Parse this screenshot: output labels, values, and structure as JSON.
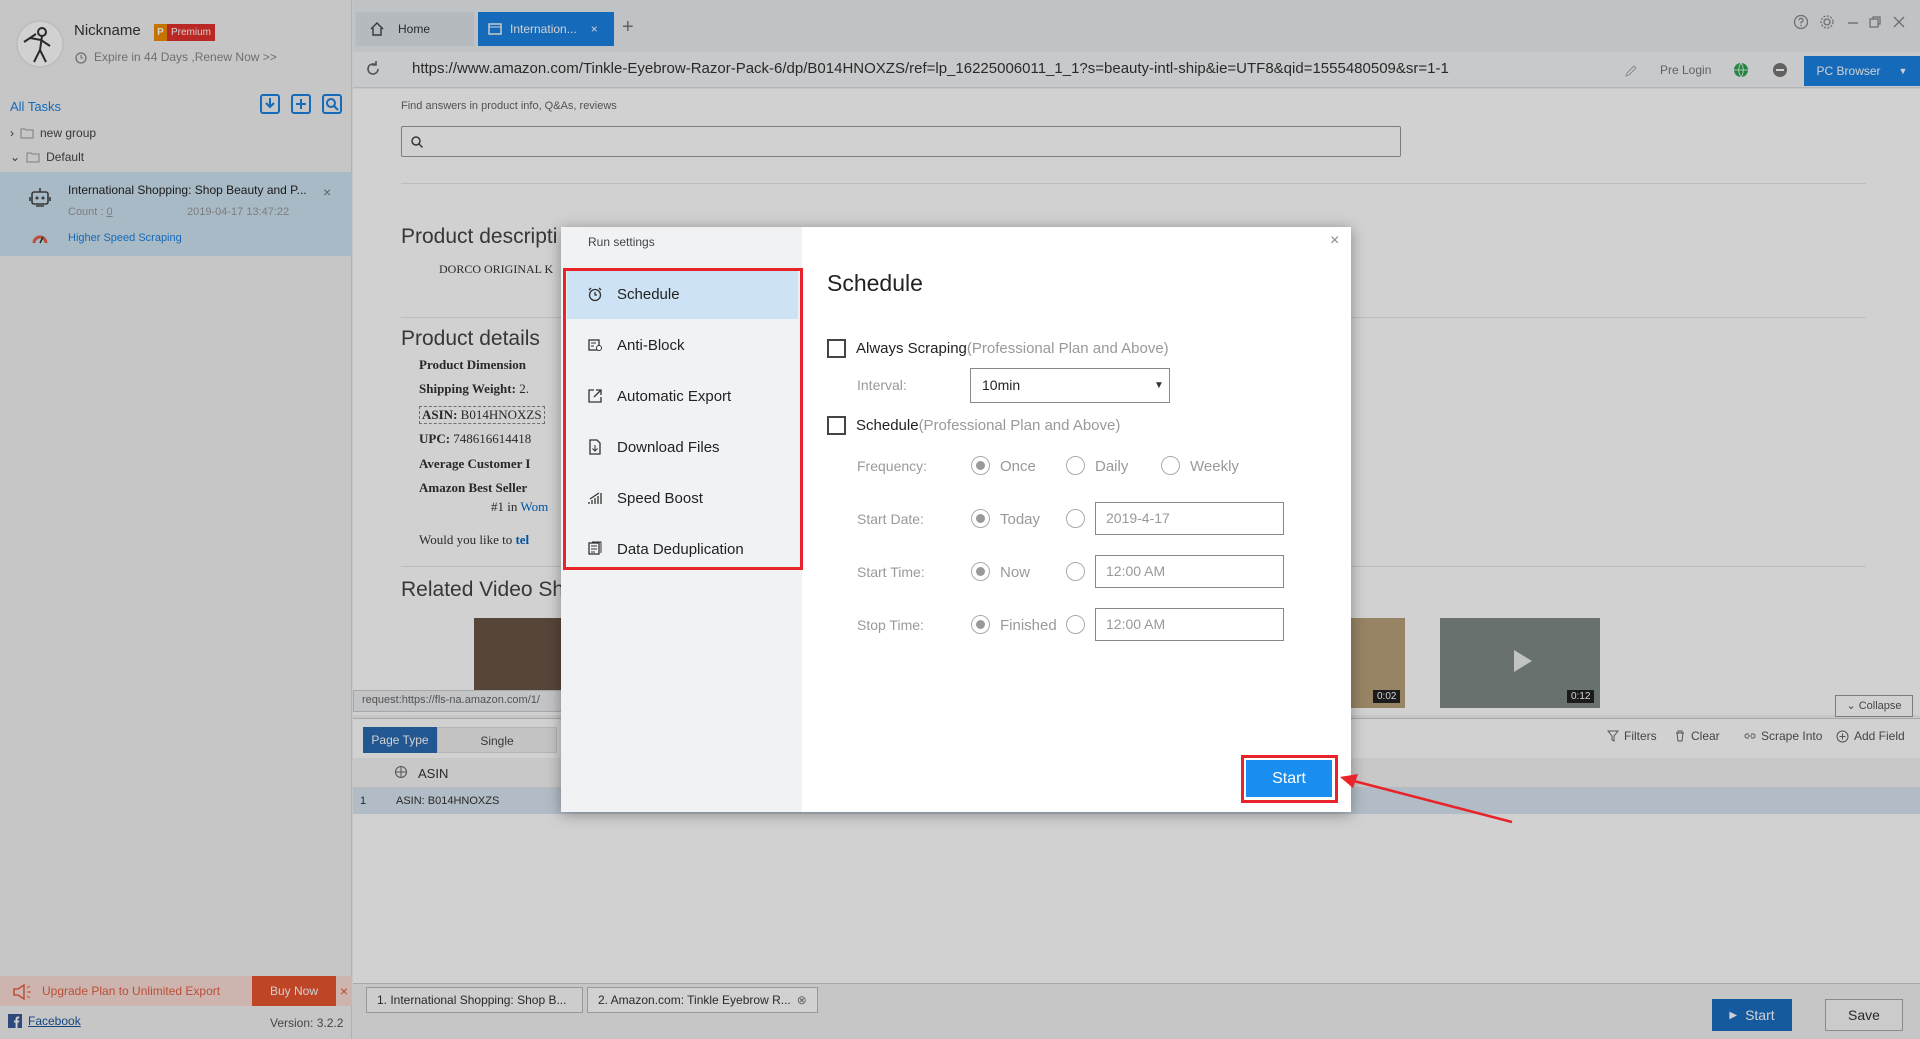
{
  "sidebar": {
    "nickname": "Nickname",
    "badge_p": "P",
    "badge_label": "Premium",
    "expire_text": "Expire in 44 Days ,Renew Now >>",
    "all_tasks": "All Tasks",
    "groups": [
      "new group",
      "Default"
    ],
    "task": {
      "title": "International Shopping: Shop Beauty and P...",
      "count_label": "Count :",
      "count_value": "0",
      "date": "2019-04-17 13:47:22",
      "speed": "Higher Speed Scraping"
    },
    "upgrade": "Upgrade Plan to Unlimited Export",
    "buy_now": "Buy Now",
    "facebook": "Facebook",
    "version": "Version: 3.2.2"
  },
  "tabs": {
    "home": "Home",
    "active": "Internation...",
    "add": "+"
  },
  "urlbar": {
    "url": "https://www.amazon.com/Tinkle-Eyebrow-Razor-Pack-6/dp/B014HNOXZS/ref=lp_16225006011_1_1?s=beauty-intl-ship&ie=UTF8&qid=1555480509&sr=1-1",
    "pre_login": "Pre Login",
    "pc_browser": "PC Browser"
  },
  "page": {
    "find_answers": "Find answers in product info, Q&As, reviews",
    "product_description": "Product descripti",
    "dorco": "DORCO ORIGINAL K",
    "product_details": "Product details",
    "details": [
      {
        "label": "Product Dimension",
        "value": ""
      },
      {
        "label": "Shipping Weight:",
        "value": " 2."
      },
      {
        "label": "ASIN:",
        "value": " B014HNOXZS"
      },
      {
        "label": "UPC:",
        "value": " 748616614418"
      },
      {
        "label": "Average Customer I",
        "value": ""
      },
      {
        "label": "Amazon Best Seller",
        "value": ""
      }
    ],
    "rank": "#1 in",
    "rank_link": "Wom",
    "would_you": "Would you like to",
    "would_link": "tel",
    "related_video": "Related Video Sh",
    "video_times": [
      "0:02",
      "0:12"
    ],
    "request": "request:https://fls-na.amazon.com/1/"
  },
  "datapanel": {
    "collapse": "Collapse",
    "page_type": "Page Type",
    "single": "Single",
    "tools": [
      "Filters",
      "Clear",
      "Scrape Into",
      "Add Field"
    ],
    "column": "ASIN",
    "row_num": "1",
    "row_value": "ASIN: B014HNOXZS"
  },
  "bottom": {
    "tabs": [
      "1. International Shopping: Shop B...",
      "2. Amazon.com: Tinkle Eyebrow R..."
    ],
    "start": "Start",
    "save": "Save"
  },
  "modal": {
    "title": "Run settings",
    "close": "×",
    "menu": [
      "Schedule",
      "Anti-Block",
      "Automatic Export",
      "Download Files",
      "Speed Boost",
      "Data Deduplication"
    ],
    "heading": "Schedule",
    "always_label": "Always Scraping",
    "always_note": "(Professional Plan and Above)",
    "interval_label": "Interval:",
    "interval_value": "10min",
    "schedule_label": "Schedule",
    "schedule_note": "(Professional Plan and Above)",
    "frequency_label": "Frequency:",
    "frequency_options": [
      "Once",
      "Daily",
      "Weekly"
    ],
    "start_date_label": "Start Date:",
    "start_date_option": "Today",
    "start_date_value": "2019-4-17",
    "start_time_label": "Start Time:",
    "start_time_option": "Now",
    "start_time_value": "12:00 AM",
    "stop_time_label": "Stop Time:",
    "stop_time_option": "Finished",
    "stop_time_value": "12:00 AM",
    "start_button": "Start"
  },
  "colors": {
    "accent": "#1a82e2",
    "highlight_red": "#e8232a",
    "premium": "#e3312d"
  }
}
